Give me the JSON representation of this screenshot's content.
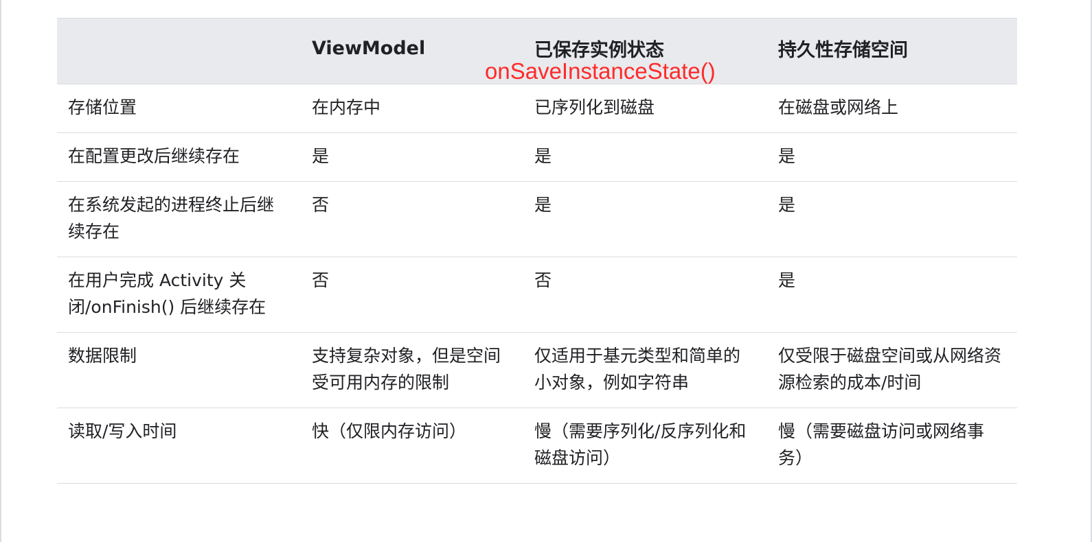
{
  "table": {
    "headers": [
      "",
      "ViewModel",
      "已保存实例状态",
      "持久性存储空间"
    ],
    "header_annotation": "onSaveInstanceState()",
    "rows": [
      [
        "存储位置",
        "在内存中",
        "已序列化到磁盘",
        "在磁盘或网络上"
      ],
      [
        "在配置更改后继续存在",
        "是",
        "是",
        "是"
      ],
      [
        "在系统发起的进程终止后继续存在",
        "否",
        "是",
        "是"
      ],
      [
        "在用户完成 Activity 关闭/onFinish() 后继续存在",
        "否",
        "否",
        "是"
      ],
      [
        "数据限制",
        "支持复杂对象，但是空间受可用内存的限制",
        "仅适用于基元类型和简单的小对象，例如字符串",
        "仅受限于磁盘空间或从网络资源检索的成本/时间"
      ],
      [
        "读取/写入时间",
        "快（仅限内存访问）",
        "慢（需要序列化/反序列化和磁盘访问）",
        "慢（需要磁盘访问或网络事务）"
      ]
    ]
  },
  "colors": {
    "header_bg": "#e8eaed",
    "border": "#dadce0",
    "text": "#202124",
    "annotation": "#ff2a2a"
  }
}
